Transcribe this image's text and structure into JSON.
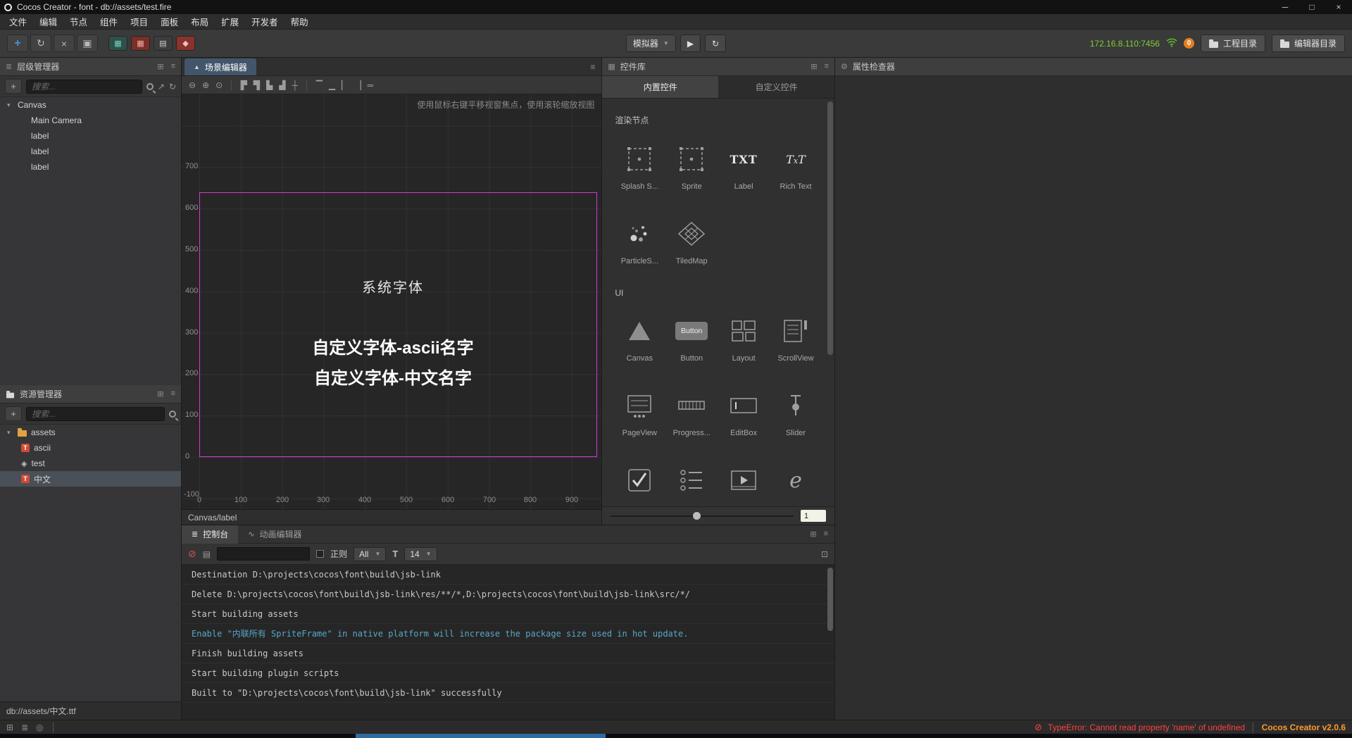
{
  "colors": {
    "accent_blue": "#4a90d9",
    "address_green": "#7fd032",
    "badge_orange": "#e67e22",
    "error_red": "#ff4040",
    "version_orange": "#ff9a2e",
    "info_cyan": "#56a8c7",
    "scene_border_magenta": "#d23bd2",
    "selection_gray": "#4a5057"
  },
  "window": {
    "title": "Cocos Creator - font - db://assets/test.fire"
  },
  "menu": {
    "items": [
      "文件",
      "编辑",
      "节点",
      "组件",
      "项目",
      "面板",
      "布局",
      "扩展",
      "开发者",
      "帮助"
    ]
  },
  "toolbar": {
    "simulator_label": "模拟器",
    "address": "172.16.8.110:7456",
    "notification_count": "0",
    "project_dir_label": "工程目录",
    "editor_dir_label": "编辑器目录"
  },
  "hierarchy": {
    "title": "层级管理器",
    "search_placeholder": "搜索...",
    "nodes": [
      {
        "label": "Canvas"
      },
      {
        "label": "Main Camera"
      },
      {
        "label": "label"
      },
      {
        "label": "label"
      },
      {
        "label": "label"
      }
    ]
  },
  "assets": {
    "title": "资源管理器",
    "search_placeholder": "搜索...",
    "items": [
      {
        "label": "assets",
        "icon": "folder-icon"
      },
      {
        "label": "ascii",
        "icon": "font-file-icon"
      },
      {
        "label": "test",
        "icon": "scene-file-icon"
      },
      {
        "label": "中文",
        "icon": "font-file-icon"
      }
    ],
    "status_path": "db://assets/中文.ttf"
  },
  "scene": {
    "tab": "场景编辑器",
    "hint": "使用鼠标右键平移视窗焦点，使用滚轮缩放视图",
    "ruler_y": [
      "700",
      "600",
      "500",
      "400",
      "300",
      "200",
      "100",
      "0"
    ],
    "ruler_y_bottom": "-100",
    "ruler_x": [
      "0",
      "100",
      "200",
      "300",
      "400",
      "500",
      "600",
      "700",
      "800",
      "900"
    ],
    "texts": [
      "系统字体",
      "自定义字体-ascii名字",
      "自定义字体-中文名字"
    ],
    "status": "Canvas/label"
  },
  "widgets": {
    "title": "控件库",
    "tabs": [
      "内置控件",
      "自定义控件"
    ],
    "heading_render": "渲染节点",
    "render_items": [
      {
        "label": "Splash S...",
        "icon": "sprite-icon"
      },
      {
        "label": "Sprite",
        "icon": "sprite-icon"
      },
      {
        "label": "Label",
        "icon": "label-icon"
      },
      {
        "label": "Rich Text",
        "icon": "richtext-icon"
      },
      {
        "label": "ParticleS...",
        "icon": "particle-icon"
      },
      {
        "label": "TiledMap",
        "icon": "tiledmap-icon"
      }
    ],
    "heading_ui": "UI",
    "ui_items": [
      {
        "label": "Canvas",
        "icon": "canvas-icon"
      },
      {
        "label": "Button",
        "icon": "button-icon"
      },
      {
        "label": "Layout",
        "icon": "layout-icon"
      },
      {
        "label": "ScrollView",
        "icon": "scrollview-icon"
      },
      {
        "label": "PageView",
        "icon": "pageview-icon"
      },
      {
        "label": "Progress...",
        "icon": "progressbar-icon"
      },
      {
        "label": "EditBox",
        "icon": "editbox-icon"
      },
      {
        "label": "Slider",
        "icon": "slider-icon"
      },
      {
        "label": "",
        "icon": "toggle-icon"
      },
      {
        "label": "",
        "icon": "togglegroup-icon"
      },
      {
        "label": "",
        "icon": "videoplayer-icon"
      },
      {
        "label": "",
        "icon": "webview-icon"
      }
    ],
    "button_icon_label": "Button",
    "zoom_value": "1"
  },
  "inspector": {
    "title": "属性检查器"
  },
  "console": {
    "tab_console": "控制台",
    "tab_animation": "动画编辑器",
    "regex_label": "正则",
    "filter_level": "All",
    "font_size": "14",
    "logs": [
      {
        "type": "log",
        "text": "Destination D:\\projects\\cocos\\font\\build\\jsb-link"
      },
      {
        "type": "log",
        "text": "Delete D:\\projects\\cocos\\font\\build\\jsb-link\\res/**/*,D:\\projects\\cocos\\font\\build\\jsb-link\\src/*/"
      },
      {
        "type": "log",
        "text": "Start building assets"
      },
      {
        "type": "info",
        "text": "Enable \"内联所有 SpriteFrame\" in native platform will increase the package size used in hot update."
      },
      {
        "type": "log",
        "text": "Finish building assets"
      },
      {
        "type": "log",
        "text": "Start building plugin scripts"
      },
      {
        "type": "log",
        "text": "Built to \"D:\\projects\\cocos\\font\\build\\jsb-link\" successfully"
      }
    ]
  },
  "statusbar": {
    "error": "TypeError: Cannot read property 'name' of undefined",
    "version": "Cocos Creator v2.0.6"
  }
}
